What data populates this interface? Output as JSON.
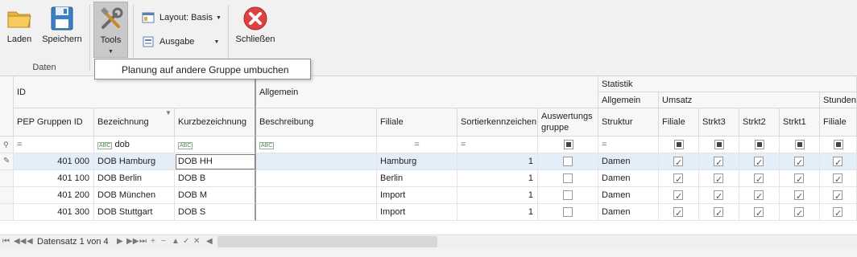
{
  "ribbon": {
    "load_label": "Laden",
    "save_label": "Speichern",
    "tools_label": "Tools",
    "layout_label": "Layout: Basis",
    "output_label": "Ausgabe",
    "close_label": "Schließen",
    "group_data_label": "Daten"
  },
  "dropdown": {
    "item": "Planung auf andere Gruppe umbuchen"
  },
  "grid": {
    "bands": {
      "id": "ID",
      "general": "Allgemein",
      "statistics": "Statistik",
      "stat_general": "Allgemein",
      "revenue": "Umsatz",
      "hours": "Stunden"
    },
    "columns": {
      "pep_id": "PEP Gruppen ID",
      "name": "Bezeichnung",
      "short": "Kurzbezeichnung",
      "desc": "Beschreibung",
      "branch": "Filiale",
      "sort": "Sortierkennzeichen",
      "eval": "Auswertungs gruppe",
      "eval_l1": "Auswertungs",
      "eval_l2": "gruppe",
      "struct": "Struktur",
      "rev_branch": "Filiale",
      "strkt3": "Strkt3",
      "strkt2": "Strkt2",
      "strkt1": "Strkt1",
      "hours_branch": "Filiale"
    },
    "filter": {
      "name_value": "dob",
      "eq": "="
    },
    "rows": [
      {
        "id": "401 000",
        "name": "DOB Hamburg",
        "short": "DOB HH",
        "branch": "Hamburg",
        "sort": "1",
        "struct": "Damen"
      },
      {
        "id": "401 100",
        "name": "DOB Berlin",
        "short": "DOB B",
        "branch": "Berlin",
        "sort": "1",
        "struct": "Damen"
      },
      {
        "id": "401 200",
        "name": "DOB München",
        "short": "DOB M",
        "branch": "Import",
        "sort": "1",
        "struct": "Damen"
      },
      {
        "id": "401 300",
        "name": "DOB Stuttgart",
        "short": "DOB S",
        "branch": "Import",
        "sort": "1",
        "struct": "Damen"
      }
    ]
  },
  "navigator": {
    "record_text": "Datensatz 1 von 4"
  },
  "colors": {
    "selected_row": "#e3eef9",
    "close_red": "#e04040"
  }
}
